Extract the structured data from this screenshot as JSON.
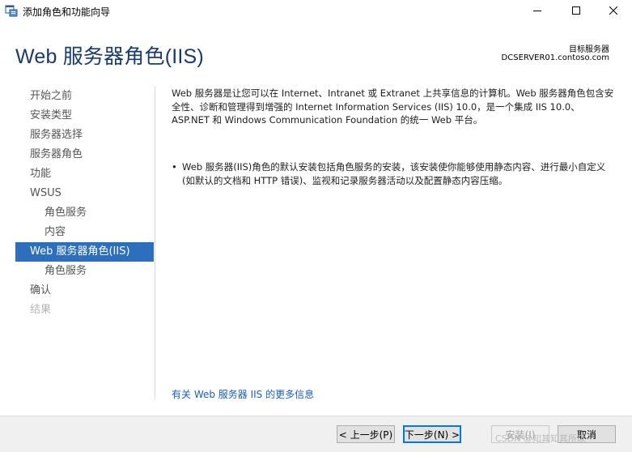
{
  "window": {
    "title": "添加角色和功能向导"
  },
  "header": {
    "title": "Web 服务器角色(IIS)",
    "target_label": "目标服务器",
    "target_server": "DCSERVER01.contoso.com"
  },
  "nav": {
    "items": [
      {
        "label": "开始之前",
        "state": "normal"
      },
      {
        "label": "安装类型",
        "state": "normal"
      },
      {
        "label": "服务器选择",
        "state": "normal"
      },
      {
        "label": "服务器角色",
        "state": "normal"
      },
      {
        "label": "功能",
        "state": "normal"
      },
      {
        "label": "WSUS",
        "state": "normal"
      },
      {
        "label": "角色服务",
        "state": "sub"
      },
      {
        "label": "内容",
        "state": "sub"
      },
      {
        "label": "Web 服务器角色(IIS)",
        "state": "active"
      },
      {
        "label": "角色服务",
        "state": "sub"
      },
      {
        "label": "确认",
        "state": "normal"
      },
      {
        "label": "结果",
        "state": "disabled"
      }
    ]
  },
  "main": {
    "intro": "Web 服务器是让您可以在 Internet、Intranet 或 Extranet 上共享信息的计算机。Web 服务器角色包含安全性、诊断和管理得到增强的 Internet Information Services (IIS) 10.0，是一个集成 IIS 10.0、ASP.NET 和 Windows Communication Foundation 的统一 Web 平台。",
    "bullet": "Web 服务器(IIS)角色的默认安装包括角色服务的安装，该安装使你能够使用静态内容、进行最小自定义(如默认的文档和 HTTP 错误)、监视和记录服务器活动以及配置静态内容压缩。",
    "bullet_marker": "•",
    "more_link": "有关 Web 服务器 IIS 的更多信息"
  },
  "footer": {
    "prev_label": "< 上一步(P)",
    "next_label": "下一步(N) >",
    "install_label": "安装(I)",
    "cancel_label": "取消"
  },
  "watermark": "CSDN @知其知其所以",
  "colors": {
    "accent": "#2e6fbd",
    "title": "#1a3a6b",
    "link": "#1a5fb4"
  }
}
